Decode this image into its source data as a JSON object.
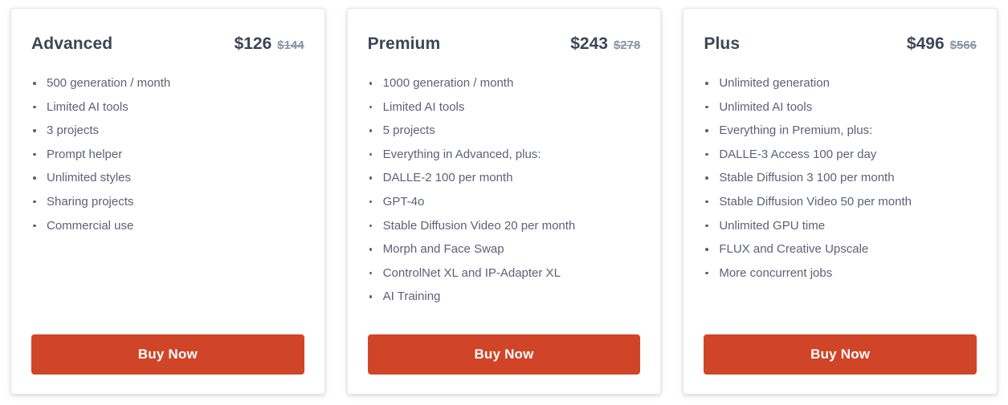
{
  "page": {
    "accent_color": "#d04427",
    "card_background": "#ffffff",
    "heading_color": "#3d4654",
    "body_text_color": "#5a6275",
    "old_price_color": "#8a94a6",
    "card_border_color": "#e8e8e8"
  },
  "plans": [
    {
      "name": "Advanced",
      "price": "$126",
      "old_price": "$144",
      "cta": "Buy Now",
      "features": [
        "500 generation / month",
        "Limited AI tools",
        "3 projects",
        "Prompt helper",
        "Unlimited styles",
        "Sharing projects",
        "Commercial use"
      ]
    },
    {
      "name": "Premium",
      "price": "$243",
      "old_price": "$278",
      "cta": "Buy Now",
      "features": [
        "1000 generation / month",
        "Limited AI tools",
        "5 projects",
        "Everything in Advanced, plus:",
        "DALLE-2 100 per month",
        "GPT-4o",
        "Stable Diffusion Video 20 per month",
        "Morph and Face Swap",
        "ControlNet XL and IP-Adapter XL",
        "AI Training"
      ]
    },
    {
      "name": "Plus",
      "price": "$496",
      "old_price": "$566",
      "cta": "Buy Now",
      "features": [
        "Unlimited generation",
        "Unlimited AI tools",
        "Everything in Premium, plus:",
        "DALLE-3 Access 100 per day",
        "Stable Diffusion 3 100 per month",
        "Stable Diffusion Video 50 per month",
        "Unlimited GPU time",
        "FLUX and Creative Upscale",
        "More concurrent jobs"
      ]
    }
  ]
}
